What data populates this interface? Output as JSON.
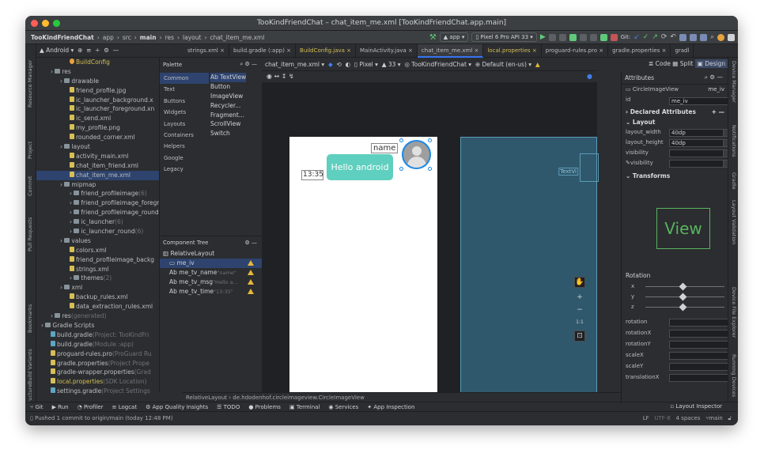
{
  "window": {
    "title": "TooKindFriendChat – chat_item_me.xml [TooKindFriendChat.app.main]"
  },
  "breadcrumb": [
    "TooKindFriendChat",
    "app",
    "src",
    "main",
    "res",
    "layout",
    "chat_item_me.xml"
  ],
  "toolbar": {
    "module": "app",
    "device": "Pixel 6 Pro API 33",
    "git_label": "Git:"
  },
  "project_view": {
    "label": "Android"
  },
  "tabs": [
    "strings.xml",
    "build.gradle (:app)",
    "BuildConfig.java",
    "MainActivity.java",
    "chat_item_me.xml",
    "local.properties",
    "proguard-rules.pro",
    "gradle.properties",
    "gradl"
  ],
  "tree": [
    {
      "depth": 3,
      "label": "BuildConfig",
      "kind": "class"
    },
    {
      "depth": 1,
      "label": "res",
      "kind": "folder"
    },
    {
      "depth": 2,
      "label": "drawable",
      "kind": "folder"
    },
    {
      "depth": 3,
      "label": "friend_profile.jpg",
      "kind": "file"
    },
    {
      "depth": 3,
      "label": "ic_launcher_background.x",
      "kind": "file"
    },
    {
      "depth": 3,
      "label": "ic_launcher_foreground.xn",
      "kind": "file"
    },
    {
      "depth": 3,
      "label": "ic_send.xml",
      "kind": "file"
    },
    {
      "depth": 3,
      "label": "my_profile.png",
      "kind": "file"
    },
    {
      "depth": 3,
      "label": "rounded_corner.xml",
      "kind": "file"
    },
    {
      "depth": 2,
      "label": "layout",
      "kind": "folder"
    },
    {
      "depth": 3,
      "label": "activity_main.xml",
      "kind": "file"
    },
    {
      "depth": 3,
      "label": "chat_item_friend.xml",
      "kind": "file"
    },
    {
      "depth": 3,
      "label": "chat_item_me.xml",
      "kind": "file",
      "selected": true
    },
    {
      "depth": 2,
      "label": "mipmap",
      "kind": "folder"
    },
    {
      "depth": 3,
      "label": "friend_profileimage",
      "kind": "folder",
      "count": "(6)"
    },
    {
      "depth": 3,
      "label": "friend_profileimage_foregr",
      "kind": "folder"
    },
    {
      "depth": 3,
      "label": "friend_profileimage_round",
      "kind": "folder"
    },
    {
      "depth": 3,
      "label": "ic_launcher",
      "kind": "folder",
      "count": "(6)"
    },
    {
      "depth": 3,
      "label": "ic_launcher_round",
      "kind": "folder",
      "count": "(6)"
    },
    {
      "depth": 2,
      "label": "values",
      "kind": "folder"
    },
    {
      "depth": 3,
      "label": "colors.xml",
      "kind": "file"
    },
    {
      "depth": 3,
      "label": "friend_profileimage_backg",
      "kind": "file"
    },
    {
      "depth": 3,
      "label": "strings.xml",
      "kind": "file"
    },
    {
      "depth": 3,
      "label": "themes",
      "kind": "folder",
      "count": "(2)"
    },
    {
      "depth": 2,
      "label": "xml",
      "kind": "folder"
    },
    {
      "depth": 3,
      "label": "backup_rules.xml",
      "kind": "file"
    },
    {
      "depth": 3,
      "label": "data_extraction_rules.xml",
      "kind": "file"
    },
    {
      "depth": 1,
      "label": "res",
      "kind": "folder",
      "count": "(generated)"
    },
    {
      "depth": 0,
      "label": "Gradle Scripts",
      "kind": "folder"
    },
    {
      "depth": 1,
      "label": "build.gradle",
      "kind": "gradle",
      "count": "(Project: TooKindFri"
    },
    {
      "depth": 1,
      "label": "build.gradle",
      "kind": "gradle",
      "count": "(Module :app)"
    },
    {
      "depth": 1,
      "label": "proguard-rules.pro",
      "kind": "file",
      "count": "(ProGuard Ru"
    },
    {
      "depth": 1,
      "label": "gradle.properties",
      "kind": "file",
      "count": "(Project Prope"
    },
    {
      "depth": 1,
      "label": "gradle-wrapper.properties",
      "kind": "file",
      "count": "(Grad"
    },
    {
      "depth": 1,
      "label": "local.properties",
      "kind": "file",
      "count": "(SDK Location)"
    },
    {
      "depth": 1,
      "label": "settings.gradle",
      "kind": "gradle",
      "count": "(Project Settings"
    }
  ],
  "palette": {
    "title": "Palette",
    "categories": [
      "Common",
      "Text",
      "Buttons",
      "Widgets",
      "Layouts",
      "Containers",
      "Helpers",
      "Google",
      "Legacy"
    ],
    "items": [
      "Ab TextView",
      "Button",
      "ImageView",
      "Recycler...",
      "Fragment...",
      "ScrollView",
      "Switch"
    ]
  },
  "component_tree": {
    "title": "Component Tree",
    "root": "RelativeLayout",
    "items": [
      {
        "label": "me_iv",
        "hint": ""
      },
      {
        "label": "me_tv_name",
        "hint": "\"name\""
      },
      {
        "label": "me_tv_msg",
        "hint": "\"Hello a..."
      },
      {
        "label": "me_tv_time",
        "hint": "\"13:35\""
      }
    ]
  },
  "editor": {
    "file_dropdown": "chat_item_me.xml",
    "device": "Pixel",
    "api": "33",
    "theme": "TooKindFriendChat",
    "locale": "Default (en-us)",
    "view_modes": [
      "Code",
      "Split",
      "Design"
    ],
    "preview": {
      "name": "name",
      "message": "Hello android",
      "time": "13:35",
      "blueprint_label": "TextVi"
    },
    "status_path": [
      "RelativeLayout",
      "de.hdodenhof.circleimageview.CircleImageView"
    ]
  },
  "attributes": {
    "title": "Attributes",
    "class_name": "CircleImageView",
    "id_short": "me_iv",
    "id_label": "id",
    "id_value": "me_iv",
    "declared_header": "Declared Attributes",
    "layout_header": "Layout",
    "rows": [
      {
        "label": "layout_width",
        "value": "40dp"
      },
      {
        "label": "layout_height",
        "value": "40dp"
      },
      {
        "label": "visibility",
        "value": ""
      },
      {
        "label": "visibility",
        "value": ""
      }
    ],
    "transforms_header": "Transforms",
    "preview_text": "View",
    "rotation_label": "Rotation",
    "rotation_axes": [
      {
        "axis": "x",
        "value": "0"
      },
      {
        "axis": "y",
        "value": "0"
      },
      {
        "axis": "z",
        "value": "0"
      }
    ],
    "transform_rows": [
      "rotation",
      "rotationX",
      "rotationY",
      "scaleX",
      "scaleY",
      "translationX"
    ]
  },
  "bottom_tools": [
    "Git",
    "Run",
    "Profiler",
    "Logcat",
    "App Quality Insights",
    "TODO",
    "Problems",
    "Terminal",
    "Services",
    "App Inspection"
  ],
  "layout_inspector": "Layout Inspector",
  "status": {
    "message": "Pushed 1 commit to origin/main (today 12:48 PM)",
    "line_ending": "LF",
    "encoding": "UTF-8",
    "indent": "4 spaces",
    "branch": "main"
  },
  "left_tool_windows": [
    "Resource Manager",
    "Project",
    "Commit",
    "Pull Requests",
    "Bookmarks",
    "Build Variants",
    "Structure"
  ],
  "right_tool_windows": [
    "Device Manager",
    "Notifications",
    "Gradle",
    "Layout Validation",
    "Device File Explorer",
    "Running Devices"
  ],
  "colors": {
    "accent": "#3574f0",
    "bubble": "#5fcfbf",
    "blueprint": "#30586c",
    "warning": "#e5b93a"
  }
}
